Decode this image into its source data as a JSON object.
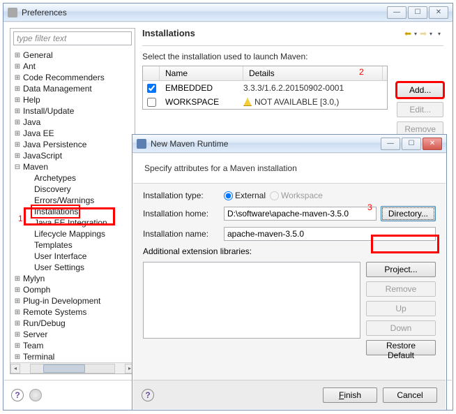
{
  "pref": {
    "title": "Preferences",
    "filter_placeholder": "type filter text",
    "heading": "Installations",
    "desc": "Select the installation used to launch Maven:",
    "table": {
      "cols": {
        "name": "Name",
        "details": "Details"
      },
      "rows": [
        {
          "checked": true,
          "name": "EMBEDDED",
          "details": "3.3.3/1.6.2.20150902-0001",
          "warn": false
        },
        {
          "checked": false,
          "name": "WORKSPACE",
          "details": "NOT AVAILABLE [3.0,)",
          "warn": true
        }
      ]
    },
    "btns": {
      "add": "Add...",
      "edit": "Edit...",
      "remove": "Remove"
    }
  },
  "tree": [
    {
      "d": 0,
      "e": "+",
      "l": "General"
    },
    {
      "d": 0,
      "e": "+",
      "l": "Ant"
    },
    {
      "d": 0,
      "e": "+",
      "l": "Code Recommenders"
    },
    {
      "d": 0,
      "e": "+",
      "l": "Data Management"
    },
    {
      "d": 0,
      "e": "+",
      "l": "Help"
    },
    {
      "d": 0,
      "e": "+",
      "l": "Install/Update"
    },
    {
      "d": 0,
      "e": "+",
      "l": "Java"
    },
    {
      "d": 0,
      "e": "+",
      "l": "Java EE"
    },
    {
      "d": 0,
      "e": "+",
      "l": "Java Persistence"
    },
    {
      "d": 0,
      "e": "+",
      "l": "JavaScript"
    },
    {
      "d": 0,
      "e": "-",
      "l": "Maven"
    },
    {
      "d": 1,
      "e": "",
      "l": "Archetypes"
    },
    {
      "d": 1,
      "e": "",
      "l": "Discovery"
    },
    {
      "d": 1,
      "e": "",
      "l": "Errors/Warnings"
    },
    {
      "d": 1,
      "e": "",
      "l": "Installations",
      "sel": true
    },
    {
      "d": 1,
      "e": "",
      "l": "Java EE Integration"
    },
    {
      "d": 1,
      "e": "",
      "l": "Lifecycle Mappings"
    },
    {
      "d": 1,
      "e": "",
      "l": "Templates"
    },
    {
      "d": 1,
      "e": "",
      "l": "User Interface"
    },
    {
      "d": 1,
      "e": "",
      "l": "User Settings"
    },
    {
      "d": 0,
      "e": "+",
      "l": "Mylyn"
    },
    {
      "d": 0,
      "e": "+",
      "l": "Oomph"
    },
    {
      "d": 0,
      "e": "+",
      "l": "Plug-in Development"
    },
    {
      "d": 0,
      "e": "+",
      "l": "Remote Systems"
    },
    {
      "d": 0,
      "e": "+",
      "l": "Run/Debug"
    },
    {
      "d": 0,
      "e": "+",
      "l": "Server"
    },
    {
      "d": 0,
      "e": "+",
      "l": "Team"
    },
    {
      "d": 0,
      "e": "+",
      "l": "Terminal"
    }
  ],
  "rt": {
    "title": "New Maven Runtime",
    "banner": "Specify attributes for a Maven installation",
    "type_label": "Installation type:",
    "type_external": "External",
    "type_workspace": "Workspace",
    "home_label": "Installation home:",
    "home_value": "D:\\software\\apache-maven-3.5.0",
    "dir_btn": "Directory...",
    "name_label": "Installation name:",
    "name_value": "apache-maven-3.5.0",
    "libs_label": "Additional extension libraries:",
    "btns": {
      "project": "Project...",
      "remove": "Remove",
      "up": "Up",
      "down": "Down",
      "restore": "Restore Default"
    },
    "finish": "Finish",
    "cancel": "Cancel"
  },
  "annot": {
    "a1": "1",
    "a2": "2",
    "a3": "3"
  },
  "glyph": {
    "min": "—",
    "max": "☐",
    "close": "✕",
    "help": "?",
    "left": "⬅",
    "right": "➡",
    "drop": "▾",
    "tl": "◂",
    "tr": "▸"
  }
}
